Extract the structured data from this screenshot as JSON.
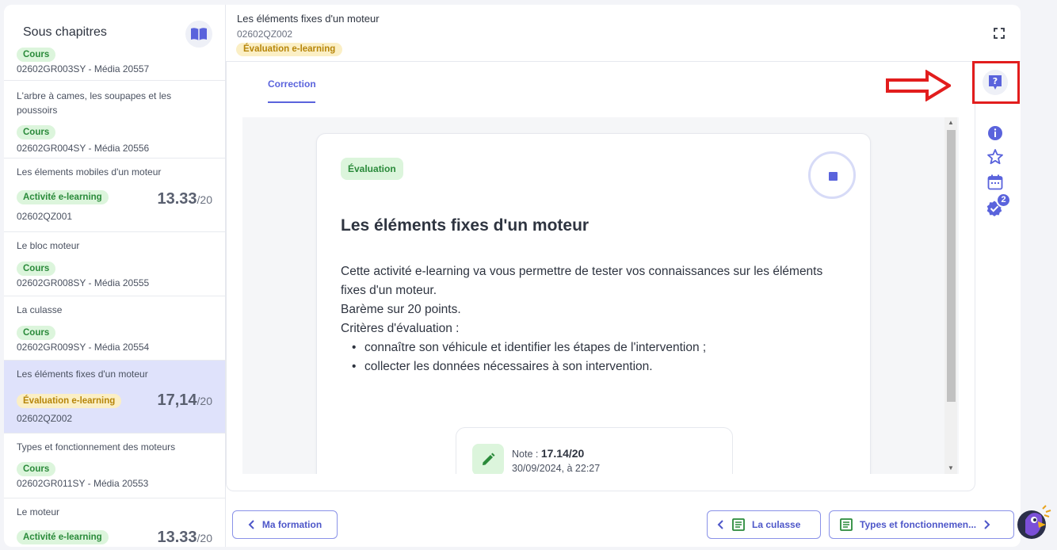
{
  "sidebar": {
    "title": "Sous chapitres",
    "items": [
      {
        "badge": "Cours",
        "code": "02602GR003SY - Média 20557"
      },
      {
        "title": "L'arbre à cames, les soupapes et les poussoirs",
        "badge": "Cours",
        "code": "02602GR004SY - Média 20556"
      },
      {
        "title": "Les élements mobiles d'un moteur",
        "badge": "Activité e-learning",
        "score": "13.33",
        "score_max": "/20",
        "code": "02602QZ001"
      },
      {
        "title": "Le bloc moteur",
        "badge": "Cours",
        "code": "02602GR008SY - Média 20555"
      },
      {
        "title": "La culasse",
        "badge": "Cours",
        "code": "02602GR009SY - Média 20554"
      },
      {
        "title": "Les éléments fixes d'un moteur",
        "badge": "Évaluation e-learning",
        "score": "17,14",
        "score_max": "/20",
        "code": "02602QZ002"
      },
      {
        "title": "Types et fonctionnement des moteurs",
        "badge": "Cours",
        "code": "02602GR011SY - Média 20553"
      },
      {
        "title": "Le moteur",
        "badge": "Activité e-learning",
        "score": "13.33",
        "score_max": "/20"
      }
    ]
  },
  "header": {
    "title": "Les éléments fixes d'un moteur",
    "code": "02602QZ002",
    "badge": "Évaluation e-learning"
  },
  "tabs": [
    {
      "label": "Correction"
    }
  ],
  "card": {
    "badge": "Évaluation",
    "title": "Les éléments fixes d'un moteur",
    "desc_1": "Cette activité e-learning va vous permettre de tester vos connaissances sur les éléments fixes d'un moteur.",
    "desc_2": "Barème sur 20 points.",
    "desc_3": "Critères d'évaluation :",
    "criteria": [
      "connaître son véhicule et identifier les étapes de l'intervention ;",
      "collecter les données nécessaires à son intervention."
    ],
    "note_label": "Note : ",
    "note_value": "17.14/20",
    "note_date": "30/09/2024, à 22:27"
  },
  "rail": {
    "badge_count": "2"
  },
  "footer": {
    "back_label": "Ma formation",
    "prev_label": "La culasse",
    "next_label": "Types et fonctionnemen..."
  },
  "colors": {
    "accent": "#5a63dc",
    "highlight": "#e21d1d",
    "green": "#2a8a3a",
    "yellow": "#b7860b"
  }
}
